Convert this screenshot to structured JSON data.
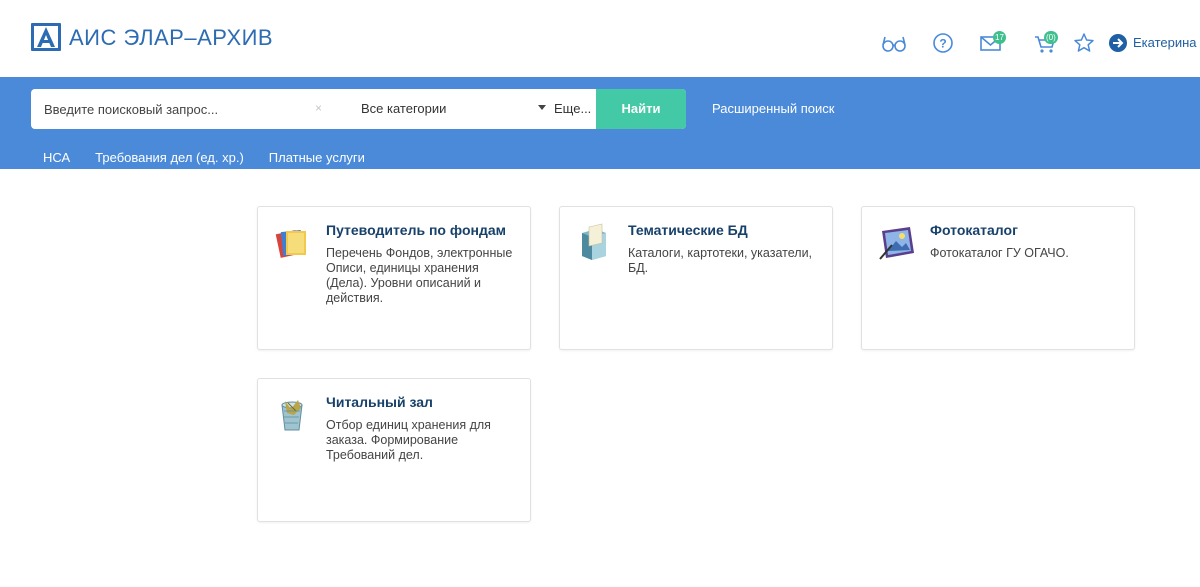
{
  "header": {
    "app_title": "АИС ЭЛАР–АРХИВ",
    "user_name": "Екатерина",
    "mail_count": "17",
    "cart_count": "(0)",
    "accent": "#2d6bb3",
    "badge_color": "#3fbf8e",
    "icons": [
      "glasses-icon",
      "help-icon",
      "mail-icon",
      "cart-icon",
      "star-icon",
      "login-icon"
    ]
  },
  "search": {
    "placeholder": "Введите поисковый запрос...",
    "clear": "×",
    "category": "Все категории",
    "more": "Еще...",
    "find_label": "Найти",
    "advanced_label": "Расширенный поиск",
    "band_color": "#4a8ad9",
    "button_color": "#43c9a5"
  },
  "nav": {
    "items": [
      "НСА",
      "Требования дел (ед. хр.)",
      "Платные услуги"
    ]
  },
  "cards": [
    {
      "title": "Путеводитель по фондам",
      "icon": "folders-icon",
      "description": "Перечень Фондов, электронные Описи, единицы хранения (Дела). Уровни описаний и действия."
    },
    {
      "title": "Тематические БД",
      "icon": "catalog-box-icon",
      "description": "Каталоги, картотеки, указатели, БД."
    },
    {
      "title": "Фотокаталог",
      "icon": "photo-album-icon",
      "description": "Фотокаталог ГУ ОГАЧО."
    },
    {
      "title": "Читальный зал",
      "icon": "basket-icon",
      "description": "Отбор единиц хранения для заказа. Формирование Требований дел."
    }
  ]
}
